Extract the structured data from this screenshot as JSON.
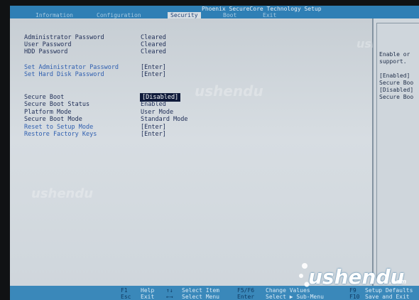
{
  "header": {
    "title": "Phoenix SecureCore Technology Setup",
    "tabs": [
      {
        "label": "Information",
        "active": false
      },
      {
        "label": "Configuration",
        "active": false
      },
      {
        "label": "Security",
        "active": true
      },
      {
        "label": "Boot",
        "active": false
      },
      {
        "label": "Exit",
        "active": false
      }
    ]
  },
  "security": {
    "rows": [
      {
        "label": "Administrator Password",
        "value": "Cleared",
        "link": false
      },
      {
        "label": "User Password",
        "value": "Cleared",
        "link": false
      },
      {
        "label": "HDD Password",
        "value": "Cleared",
        "link": false
      },
      {
        "label": "Set Administrator Password",
        "value": "[Enter]",
        "link": true
      },
      {
        "label": "Set Hard Disk Password",
        "value": "[Enter]",
        "link": true
      },
      {
        "label": "Secure Boot",
        "value": "[Disabled]",
        "link": false,
        "selected": true
      },
      {
        "label": "Secure Boot Status",
        "value": "Enabled",
        "link": false
      },
      {
        "label": "Platform Mode",
        "value": "User Mode",
        "link": false
      },
      {
        "label": "Secure Boot Mode",
        "value": "Standard Mode",
        "link": false
      },
      {
        "label": "Reset to Setup Mode",
        "value": "[Enter]",
        "link": true
      },
      {
        "label": "Restore Factory Keys",
        "value": "[Enter]",
        "link": true
      }
    ]
  },
  "help": {
    "lines": [
      "Enable or",
      "support.",
      "",
      "[Enabled]",
      "Secure Boo",
      "[Disabled]",
      "Secure Boo"
    ]
  },
  "footer": {
    "keys": [
      {
        "key": "F1",
        "desc": "Help"
      },
      {
        "key": "Esc",
        "desc": "Exit"
      },
      {
        "key": "↑↓",
        "desc": "Select Item"
      },
      {
        "key": "←→",
        "desc": "Select Menu"
      },
      {
        "key": "F5/F6",
        "desc": "Change Values"
      },
      {
        "key": "Enter",
        "desc": "Select ▶ Sub-Menu"
      },
      {
        "key": "F9",
        "desc": "Setup Defaults"
      },
      {
        "key": "F10",
        "desc": "Save and Exit"
      }
    ]
  },
  "watermark": {
    "text": "ushendu",
    "url": ".com"
  },
  "colors": {
    "bar_blue": "#2f7fb5",
    "text_dark": "#1e2d56",
    "link_blue": "#2f5fb0",
    "selected_bg": "#0f1a3a"
  }
}
